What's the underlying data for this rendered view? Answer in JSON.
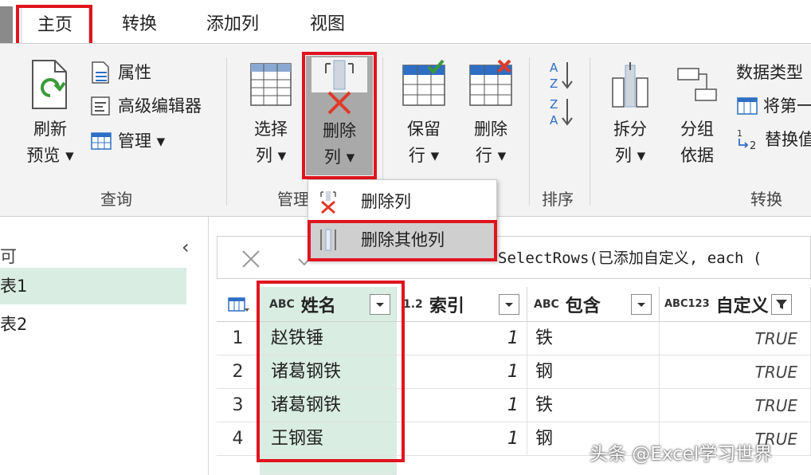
{
  "tabs": [
    {
      "label": "主页",
      "active": true
    },
    {
      "label": "转换",
      "active": false
    },
    {
      "label": "添加列",
      "active": false
    },
    {
      "label": "视图",
      "active": false
    }
  ],
  "ribbon": {
    "refresh_line1": "刷新",
    "refresh_line2": "预览 ▾",
    "properties": "属性",
    "advanced_editor": "高级编辑器",
    "manage": "管理 ▾",
    "group_query": "查询",
    "choose_line1": "选择",
    "choose_line2": "列 ▾",
    "remove_line1": "删除",
    "remove_line2": "列 ▾",
    "group_manage": "管理",
    "keep_line1": "保留",
    "keep_line2": "行 ▾",
    "remove_rows_line1": "删除",
    "remove_rows_line2": "行 ▾",
    "group_sort": "排序",
    "split_line1": "拆分",
    "split_line2": "列 ▾",
    "groupby_line1": "分组",
    "groupby_line2": "依据",
    "data_type": "数据类型",
    "first_row": "将第一",
    "replace": "替换值",
    "group_transform": "转换"
  },
  "dropdown": {
    "remove_columns": "删除列",
    "remove_other_columns": "删除其他列"
  },
  "queries": {
    "top_label": "可",
    "items": [
      "表1",
      "表2"
    ]
  },
  "formula": {
    "text": "SelectRows(已添加自定义, each ("
  },
  "grid": {
    "columns": [
      {
        "name": "姓名",
        "type": "ABC"
      },
      {
        "name": "索引",
        "type": "1.2"
      },
      {
        "name": "包含",
        "type": "ABC"
      },
      {
        "name": "自定义",
        "type": "ABC123"
      }
    ],
    "rows": [
      {
        "n": "1",
        "name": "赵铁锤",
        "idx": "1",
        "contains": "铁",
        "custom": "TRUE"
      },
      {
        "n": "2",
        "name": "诸葛钢铁",
        "idx": "1",
        "contains": "钢",
        "custom": "TRUE"
      },
      {
        "n": "3",
        "name": "诸葛钢铁",
        "idx": "1",
        "contains": "铁",
        "custom": "TRUE"
      },
      {
        "n": "4",
        "name": "王钢蛋",
        "idx": "1",
        "contains": "钢",
        "custom": "TRUE"
      }
    ]
  },
  "watermark": "头条 @Excel学习世界",
  "colors": {
    "highlight": "#e0141e",
    "selected_column": "#d9ede3",
    "accent_blue": "#2e6fc4",
    "accent_green": "#3a9a3a",
    "accent_red": "#e03a2a"
  }
}
